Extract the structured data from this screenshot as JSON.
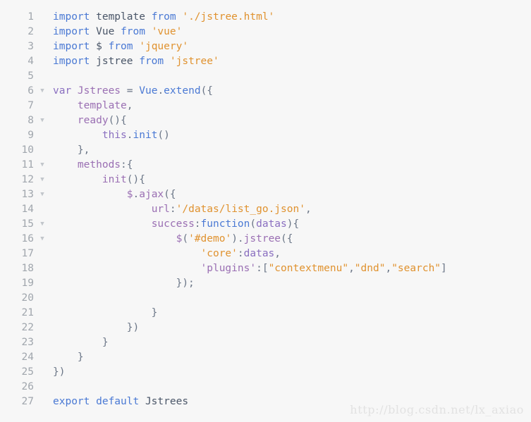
{
  "editor": {
    "background_color": "#f7f7f7",
    "line_number_color": "#a0a6ad",
    "fold_marker_glyph": "▼",
    "first_line": 1,
    "last_line": 27,
    "language": "javascript"
  },
  "palette": {
    "keyword": "#4a79d4",
    "string": "#e0922f",
    "identifier": "#9a6fb3",
    "punctuation": "#6b7687",
    "plain": "#4a5668",
    "variable": "#8a6fc0"
  },
  "lines": [
    {
      "n": "1",
      "fold": false,
      "tokens": [
        {
          "t": "import ",
          "c": "kw"
        },
        {
          "t": "template ",
          "c": "plain"
        },
        {
          "t": "from ",
          "c": "kw"
        },
        {
          "t": "'./jstree.html'",
          "c": "str"
        }
      ]
    },
    {
      "n": "2",
      "fold": false,
      "tokens": [
        {
          "t": "import ",
          "c": "kw"
        },
        {
          "t": "Vue ",
          "c": "plain"
        },
        {
          "t": "from ",
          "c": "kw"
        },
        {
          "t": "'vue'",
          "c": "str"
        }
      ]
    },
    {
      "n": "3",
      "fold": false,
      "tokens": [
        {
          "t": "import ",
          "c": "kw"
        },
        {
          "t": "$ ",
          "c": "plain"
        },
        {
          "t": "from ",
          "c": "kw"
        },
        {
          "t": "'jquery'",
          "c": "str"
        }
      ]
    },
    {
      "n": "4",
      "fold": false,
      "tokens": [
        {
          "t": "import ",
          "c": "kw"
        },
        {
          "t": "jstree ",
          "c": "plain"
        },
        {
          "t": "from ",
          "c": "kw"
        },
        {
          "t": "'jstree'",
          "c": "str"
        }
      ]
    },
    {
      "n": "5",
      "fold": false,
      "tokens": []
    },
    {
      "n": "6",
      "fold": true,
      "tokens": [
        {
          "t": "var ",
          "c": "var"
        },
        {
          "t": "Jstrees",
          "c": "id"
        },
        {
          "t": " = ",
          "c": "punc"
        },
        {
          "t": "Vue",
          "c": "kw"
        },
        {
          "t": ".",
          "c": "punc"
        },
        {
          "t": "extend",
          "c": "kw"
        },
        {
          "t": "({",
          "c": "punc"
        }
      ]
    },
    {
      "n": "7",
      "fold": false,
      "tokens": [
        {
          "t": "    ",
          "c": "plain"
        },
        {
          "t": "template",
          "c": "id"
        },
        {
          "t": ",",
          "c": "punc"
        }
      ]
    },
    {
      "n": "8",
      "fold": true,
      "tokens": [
        {
          "t": "    ",
          "c": "plain"
        },
        {
          "t": "ready",
          "c": "id"
        },
        {
          "t": "(){",
          "c": "punc"
        }
      ]
    },
    {
      "n": "9",
      "fold": false,
      "tokens": [
        {
          "t": "        ",
          "c": "plain"
        },
        {
          "t": "this",
          "c": "var"
        },
        {
          "t": ".",
          "c": "punc"
        },
        {
          "t": "init",
          "c": "kw"
        },
        {
          "t": "()",
          "c": "punc"
        }
      ]
    },
    {
      "n": "10",
      "fold": false,
      "tokens": [
        {
          "t": "    },",
          "c": "punc"
        }
      ]
    },
    {
      "n": "11",
      "fold": true,
      "tokens": [
        {
          "t": "    ",
          "c": "plain"
        },
        {
          "t": "methods",
          "c": "id"
        },
        {
          "t": ":{",
          "c": "punc"
        }
      ]
    },
    {
      "n": "12",
      "fold": true,
      "tokens": [
        {
          "t": "        ",
          "c": "plain"
        },
        {
          "t": "init",
          "c": "id"
        },
        {
          "t": "(){",
          "c": "punc"
        }
      ]
    },
    {
      "n": "13",
      "fold": true,
      "tokens": [
        {
          "t": "            ",
          "c": "plain"
        },
        {
          "t": "$",
          "c": "id"
        },
        {
          "t": ".",
          "c": "punc"
        },
        {
          "t": "ajax",
          "c": "id"
        },
        {
          "t": "({",
          "c": "punc"
        }
      ]
    },
    {
      "n": "14",
      "fold": false,
      "tokens": [
        {
          "t": "                ",
          "c": "plain"
        },
        {
          "t": "url",
          "c": "id"
        },
        {
          "t": ":",
          "c": "punc"
        },
        {
          "t": "'/datas/list_go.json'",
          "c": "str"
        },
        {
          "t": ",",
          "c": "punc"
        }
      ]
    },
    {
      "n": "15",
      "fold": true,
      "tokens": [
        {
          "t": "                ",
          "c": "plain"
        },
        {
          "t": "success",
          "c": "id"
        },
        {
          "t": ":",
          "c": "punc"
        },
        {
          "t": "function",
          "c": "kw"
        },
        {
          "t": "(",
          "c": "punc"
        },
        {
          "t": "datas",
          "c": "var"
        },
        {
          "t": "){",
          "c": "punc"
        }
      ]
    },
    {
      "n": "16",
      "fold": true,
      "tokens": [
        {
          "t": "                    ",
          "c": "plain"
        },
        {
          "t": "$",
          "c": "id"
        },
        {
          "t": "(",
          "c": "punc"
        },
        {
          "t": "'#demo'",
          "c": "str"
        },
        {
          "t": ")",
          "c": "punc"
        },
        {
          "t": ".",
          "c": "punc"
        },
        {
          "t": "jstree",
          "c": "id"
        },
        {
          "t": "({",
          "c": "punc"
        }
      ]
    },
    {
      "n": "17",
      "fold": false,
      "tokens": [
        {
          "t": "                        ",
          "c": "plain"
        },
        {
          "t": "'core'",
          "c": "str"
        },
        {
          "t": ":",
          "c": "punc"
        },
        {
          "t": "datas",
          "c": "var"
        },
        {
          "t": ",",
          "c": "punc"
        }
      ]
    },
    {
      "n": "18",
      "fold": false,
      "tokens": [
        {
          "t": "                        ",
          "c": "plain"
        },
        {
          "t": "'plugins'",
          "c": "id"
        },
        {
          "t": ":[",
          "c": "punc"
        },
        {
          "t": "\"contextmenu\"",
          "c": "str"
        },
        {
          "t": ",",
          "c": "punc"
        },
        {
          "t": "\"dnd\"",
          "c": "str"
        },
        {
          "t": ",",
          "c": "punc"
        },
        {
          "t": "\"search\"",
          "c": "str"
        },
        {
          "t": "]",
          "c": "punc"
        }
      ]
    },
    {
      "n": "19",
      "fold": false,
      "tokens": [
        {
          "t": "                    });",
          "c": "punc"
        }
      ]
    },
    {
      "n": "20",
      "fold": false,
      "tokens": []
    },
    {
      "n": "21",
      "fold": false,
      "tokens": [
        {
          "t": "                }",
          "c": "punc"
        }
      ]
    },
    {
      "n": "22",
      "fold": false,
      "tokens": [
        {
          "t": "            })",
          "c": "punc"
        }
      ]
    },
    {
      "n": "23",
      "fold": false,
      "tokens": [
        {
          "t": "        }",
          "c": "punc"
        }
      ]
    },
    {
      "n": "24",
      "fold": false,
      "tokens": [
        {
          "t": "    }",
          "c": "punc"
        }
      ]
    },
    {
      "n": "25",
      "fold": false,
      "tokens": [
        {
          "t": "})",
          "c": "punc"
        }
      ]
    },
    {
      "n": "26",
      "fold": false,
      "tokens": []
    },
    {
      "n": "27",
      "fold": false,
      "tokens": [
        {
          "t": "export default ",
          "c": "kw"
        },
        {
          "t": "Jstrees",
          "c": "plain"
        }
      ]
    }
  ],
  "watermark": {
    "text": "http://blog.csdn.net/lx_axiao"
  }
}
